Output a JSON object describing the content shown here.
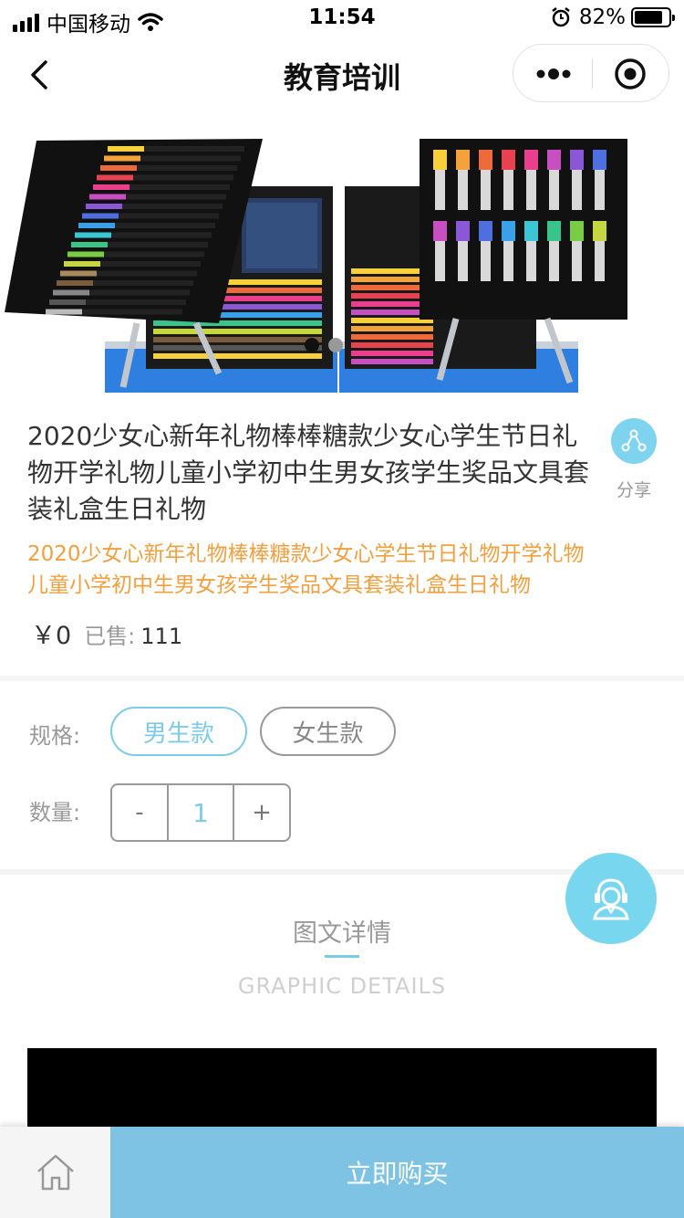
{
  "status_bar": {
    "carrier": "中国移动",
    "time": "11:54",
    "battery_percent": "82%",
    "battery_level": 0.82,
    "icons": [
      "signal-icon",
      "wifi-icon",
      "alarm-icon",
      "battery-icon"
    ]
  },
  "nav": {
    "title": "教育培训",
    "icons": [
      "back-icon",
      "more-icon",
      "target-icon"
    ]
  },
  "product": {
    "image_icon": "art-supplies-case-image",
    "title": "2020少女心新年礼物棒棒糖款少女心学生节日礼物开学礼物儿童小学初中生男女孩学生奖品文具套装礼盒生日礼物",
    "subtitle": "2020少女心新年礼物棒棒糖款少女心学生节日礼物开学礼物儿童小学初中生男女孩学生奖品文具套装礼盒生日礼物",
    "price": "￥0",
    "sold_label": "已售:",
    "sold_value": "111",
    "share_label": "分享"
  },
  "spec": {
    "label": "规格:",
    "options": [
      {
        "label": "男生款",
        "selected": true
      },
      {
        "label": "女生款",
        "selected": false
      }
    ]
  },
  "quantity": {
    "label": "数量:",
    "minus": "-",
    "value": "1",
    "plus": "+"
  },
  "details": {
    "title": "图文详情",
    "subtitle": "GRAPHIC DETAILS"
  },
  "bottom": {
    "buy_label": "立即购买",
    "icons": [
      "home-icon",
      "customer-service-icon"
    ]
  },
  "colors": {
    "accent": "#7ecbe8",
    "orange_text": "#f0a040",
    "buy_button": "#7ec3e4"
  }
}
